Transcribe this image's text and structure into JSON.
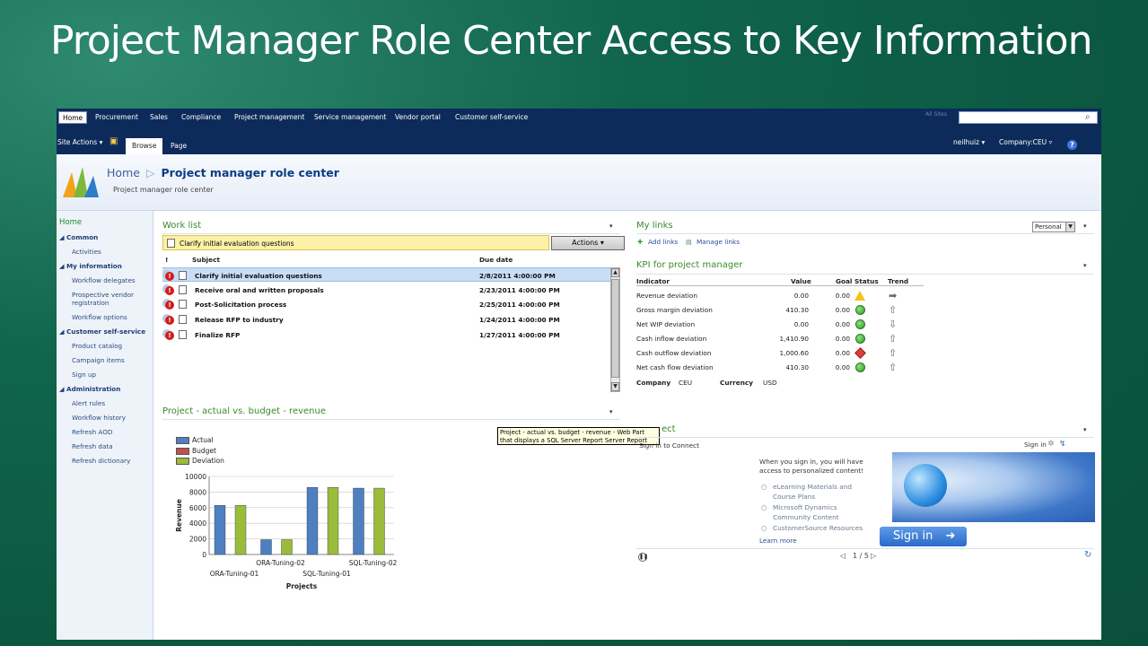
{
  "slide": {
    "title": "Project Manager Role Center Access to Key Information"
  },
  "topnav": {
    "tabs": [
      "Home",
      "Procurement",
      "Sales",
      "Compliance",
      "Project management",
      "Service management",
      "Vendor portal",
      "Customer self-service"
    ],
    "search_hint": "All Sites"
  },
  "ribbon": {
    "site_actions": "Site Actions ▾",
    "tab_browse": "Browse",
    "tab_page": "Page",
    "user": "neilhuiz ▾",
    "company": "Company:CEU ▿",
    "help": "?"
  },
  "header": {
    "crumb_home": "Home",
    "crumb_sep": "▷",
    "crumb_current": "Project manager role center",
    "subtitle": "Project manager role center"
  },
  "leftnav": {
    "items": [
      {
        "label": "Home",
        "kind": "home"
      },
      {
        "label": "◢ Common",
        "kind": "sec"
      },
      {
        "label": "Activities",
        "kind": "sub"
      },
      {
        "label": "◢ My information",
        "kind": "sec"
      },
      {
        "label": "Workflow delegates",
        "kind": "sub"
      },
      {
        "label": "Prospective vendor",
        "kind": "sub"
      },
      {
        "label": "registration",
        "kind": "sub"
      },
      {
        "label": "Workflow options",
        "kind": "sub"
      },
      {
        "label": "◢ Customer self-service",
        "kind": "sec"
      },
      {
        "label": "Product catalog",
        "kind": "sub"
      },
      {
        "label": "Campaign items",
        "kind": "sub"
      },
      {
        "label": "Sign up",
        "kind": "sub"
      },
      {
        "label": "◢ Administration",
        "kind": "sec"
      },
      {
        "label": "Alert rules",
        "kind": "sub"
      },
      {
        "label": "Workflow history",
        "kind": "sub"
      },
      {
        "label": "Refresh AOD",
        "kind": "sub"
      },
      {
        "label": "Refresh data",
        "kind": "sub"
      },
      {
        "label": "Refresh dictionary",
        "kind": "sub"
      }
    ]
  },
  "worklist": {
    "title": "Work list",
    "menu": "▾",
    "selected_item": "Clarify initial evaluation questions",
    "actions_label": "Actions ▾",
    "col_flag": "!",
    "col_subject": "Subject",
    "col_due": "Due date",
    "rows": [
      {
        "subject": "Clarify initial evaluation questions",
        "due": "2/8/2011 4:00:00 PM"
      },
      {
        "subject": "Receive oral and written proposals",
        "due": "2/23/2011 4:00:00 PM"
      },
      {
        "subject": "Post-Solicitation process",
        "due": "2/25/2011 4:00:00 PM"
      },
      {
        "subject": "Release RFP to industry",
        "due": "1/24/2011 4:00:00 PM"
      },
      {
        "subject": "Finalize RFP",
        "due": "1/27/2011 4:00:00 PM"
      }
    ]
  },
  "chart_part": {
    "title": "Project - actual vs. budget - revenue",
    "menu": "▾",
    "tooltip": "Project - actual vs. budget - revenue - Web Part that displays a SQL Server Report Server Report"
  },
  "chart_data": {
    "type": "bar",
    "categories": [
      "ORA-Tuning-01",
      "ORA-Tuning-02",
      "SQL-Tuning-01",
      "SQL-Tuning-02"
    ],
    "series": [
      {
        "name": "Actual",
        "values": [
          6300,
          1900,
          8600,
          8500
        ]
      },
      {
        "name": "Budget",
        "values": [
          0,
          0,
          0,
          0
        ]
      },
      {
        "name": "Deviation",
        "values": [
          6300,
          1900,
          8600,
          8500
        ]
      }
    ],
    "ylabel": "Revenue",
    "xlabel": "Projects",
    "ylim": [
      0,
      10000
    ],
    "yticks": [
      "0",
      "2000",
      "4000",
      "6000",
      "8000",
      "10000"
    ],
    "colors": {
      "Actual": "#4f7fbf",
      "Budget": "#c0504d",
      "Deviation": "#9bbb3b"
    }
  },
  "mylinks": {
    "title": "My links",
    "view": "Personal",
    "add": "Add links",
    "manage": "Manage links"
  },
  "kpi": {
    "title": "KPI for project manager",
    "headers": {
      "indicator": "Indicator",
      "value": "Value",
      "goal": "Goal",
      "status": "Status",
      "trend": "Trend"
    },
    "rows": [
      {
        "indicator": "Revenue deviation",
        "value": "0.00",
        "goal": "0.00",
        "status": "yellow",
        "trend": "➡"
      },
      {
        "indicator": "Gross margin deviation",
        "value": "410.30",
        "goal": "0.00",
        "status": "green",
        "trend": "⇧"
      },
      {
        "indicator": "Net WIP deviation",
        "value": "0.00",
        "goal": "0.00",
        "status": "green",
        "trend": "⇩"
      },
      {
        "indicator": "Cash inflow deviation",
        "value": "1,410.90",
        "goal": "0.00",
        "status": "green",
        "trend": "⇧"
      },
      {
        "indicator": "Cash outflow deviation",
        "value": "1,000.60",
        "goal": "0.00",
        "status": "red",
        "trend": "⇧"
      },
      {
        "indicator": "Net cash flow deviation",
        "value": "410.30",
        "goal": "0.00",
        "status": "green",
        "trend": "⇧"
      }
    ],
    "company_label": "Company",
    "company_value": "CEU",
    "currency_label": "Currency",
    "currency_value": "USD"
  },
  "connect": {
    "title": "ect",
    "signin_to_connect": "Sign in to Connect",
    "signin_link": "Sign in",
    "pitch_line1": "When you sign in, you will have",
    "pitch_line2": "access to personalized content!",
    "bullets": [
      "eLearning Materials and",
      "Course Plans",
      "Microsoft Dynamics",
      "Community Content",
      "CustomerSource Resources"
    ],
    "learn_more": "Learn more",
    "signin_button": "Sign in",
    "pager": "1 / 5"
  }
}
